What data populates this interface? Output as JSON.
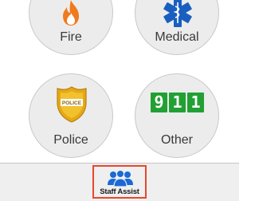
{
  "tiles": {
    "fire": {
      "label": "Fire",
      "icon": "fire-icon",
      "color": "#f07a1e"
    },
    "medical": {
      "label": "Medical",
      "icon": "star-of-life-icon",
      "color": "#1a5fbf"
    },
    "police": {
      "label": "Police",
      "icon": "police-badge-icon",
      "color": "#e6a817",
      "badge_text": "POLICE"
    },
    "other": {
      "label": "Other",
      "digits": [
        "9",
        "1",
        "1"
      ],
      "color": "#22a033"
    }
  },
  "tab_bar": {
    "staff_assist": {
      "label": "Staff Assist",
      "icon": "group-icon",
      "highlight_color": "#e8472f",
      "icon_color": "#1a6ad6"
    }
  }
}
